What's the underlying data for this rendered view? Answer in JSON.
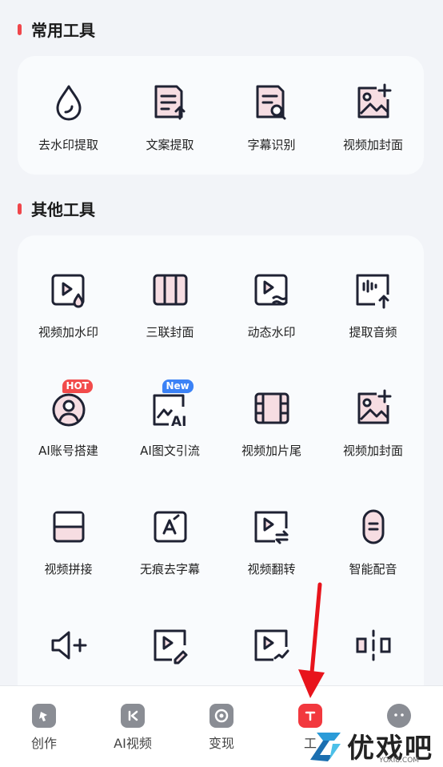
{
  "common": {
    "title": "常用工具",
    "tools": [
      {
        "label": "去水印提取",
        "icon": "water-drop-icon"
      },
      {
        "label": "文案提取",
        "icon": "document-export-icon"
      },
      {
        "label": "字幕识别",
        "icon": "subtitle-search-icon"
      },
      {
        "label": "视频加封面",
        "icon": "image-add-icon"
      }
    ]
  },
  "other": {
    "title": "其他工具",
    "tools": [
      {
        "label": "视频加水印",
        "icon": "video-watermark-icon"
      },
      {
        "label": "三联封面",
        "icon": "triple-cover-icon"
      },
      {
        "label": "动态水印",
        "icon": "dynamic-watermark-icon"
      },
      {
        "label": "提取音频",
        "icon": "extract-audio-icon"
      },
      {
        "label": "AI账号搭建",
        "icon": "ai-account-icon",
        "badge": "HOT"
      },
      {
        "label": "AI图文引流",
        "icon": "ai-article-icon",
        "badge": "New"
      },
      {
        "label": "视频加片尾",
        "icon": "video-ending-icon"
      },
      {
        "label": "视频加封面",
        "icon": "image-add-icon"
      },
      {
        "label": "视频拼接",
        "icon": "video-join-icon"
      },
      {
        "label": "无痕去字幕",
        "icon": "remove-subtitle-icon"
      },
      {
        "label": "视频翻转",
        "icon": "video-flip-icon"
      },
      {
        "label": "智能配音",
        "icon": "smart-dubbing-icon"
      }
    ],
    "partial_row_icons": [
      "volume-add-icon",
      "video-edit-icon",
      "video-check-icon",
      "mirror-split-icon"
    ]
  },
  "tabbar": {
    "tabs": [
      {
        "label": "创作",
        "icon": "create-icon"
      },
      {
        "label": "AI视频",
        "icon": "ai-video-icon"
      },
      {
        "label": "变现",
        "icon": "monetize-icon"
      },
      {
        "label": "工",
        "icon": "tools-icon",
        "active": true
      },
      {
        "label": "",
        "icon": "chat-icon"
      }
    ]
  },
  "watermark": {
    "big": "优戏吧",
    "small": "YOXI8.COM"
  },
  "colors": {
    "accent": "#f0464b",
    "active_tab": "#f2383e",
    "icon_fill": "#f6dde2"
  }
}
